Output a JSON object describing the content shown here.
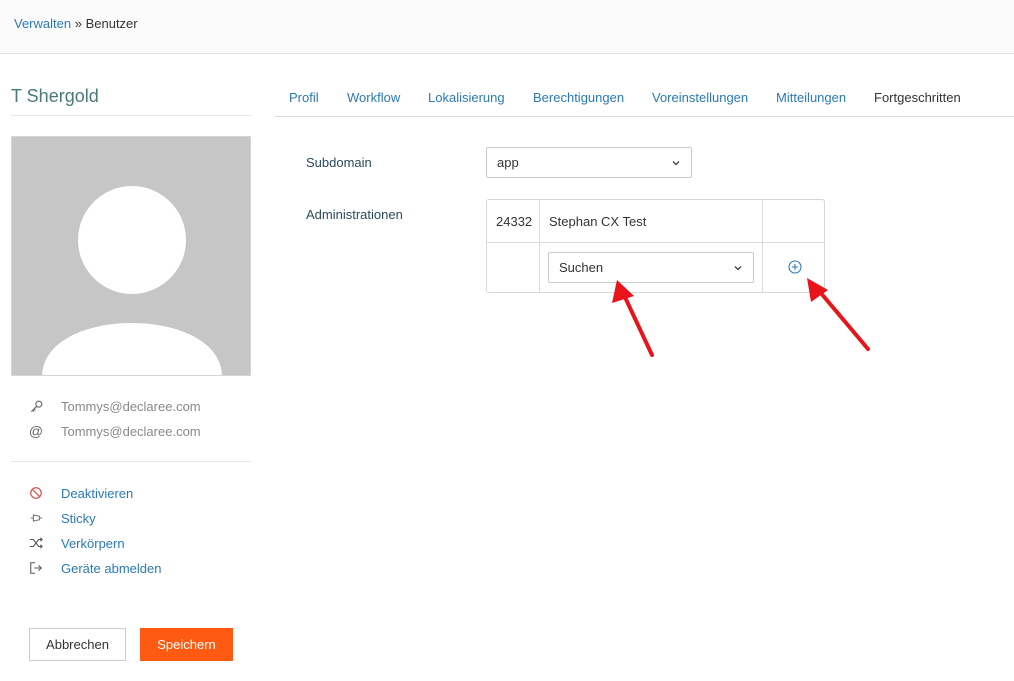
{
  "breadcrumb": {
    "parent": "Verwalten",
    "separator": "»",
    "current": "Benutzer"
  },
  "user": {
    "name": "T Shergold",
    "username": "Tommys@declaree.com",
    "email": "Tommys@declaree.com"
  },
  "actions": [
    {
      "label": "Deaktivieren",
      "icon": "ban-icon"
    },
    {
      "label": "Sticky",
      "icon": "pin-icon"
    },
    {
      "label": "Verkörpern",
      "icon": "shuffle-icon"
    },
    {
      "label": "Geräte abmelden",
      "icon": "sign-out-icon"
    }
  ],
  "buttons": {
    "cancel": "Abbrechen",
    "save": "Speichern"
  },
  "tabs": [
    {
      "label": "Profil",
      "active": false
    },
    {
      "label": "Workflow",
      "active": false
    },
    {
      "label": "Lokalisierung",
      "active": false
    },
    {
      "label": "Berechtigungen",
      "active": false
    },
    {
      "label": "Voreinstellungen",
      "active": false
    },
    {
      "label": "Mitteilungen",
      "active": false
    },
    {
      "label": "Fortgeschritten",
      "active": true
    }
  ],
  "form": {
    "subdomain": {
      "label": "Subdomain",
      "value": "app"
    },
    "administrations": {
      "label": "Administrationen",
      "rows": [
        {
          "id": "24332",
          "name": "Stephan CX Test"
        }
      ],
      "search_placeholder": "Suchen"
    }
  },
  "colors": {
    "link": "#2a7ab8",
    "save": "#ff5a12",
    "annotation": "#e8141a"
  }
}
